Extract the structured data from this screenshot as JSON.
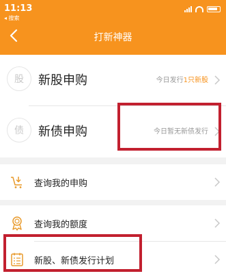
{
  "status_bar": {
    "time": "11:13",
    "back_app": "◂ 搜索"
  },
  "nav": {
    "title": "打新神器"
  },
  "ipo_row": {
    "icon_char": "股",
    "label": "新股申购",
    "right_prefix": "今日发行",
    "right_count": "1只新股"
  },
  "bond_row": {
    "icon_char": "债",
    "label": "新债申购",
    "right_text": "今日暂无新债发行"
  },
  "menu": {
    "my_subscriptions": "查询我的申购",
    "my_quota": "查询我的额度",
    "issuance_plan": "新股、新债发行计划"
  },
  "colors": {
    "accent": "#f7931e",
    "highlight_box": "#c2202f"
  }
}
